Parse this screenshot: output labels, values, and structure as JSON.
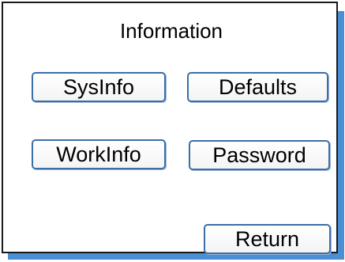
{
  "window": {
    "title": "Information"
  },
  "buttons": {
    "sysinfo": "SysInfo",
    "defaults": "Defaults",
    "workinfo": "WorkInfo",
    "password": "Password",
    "return": "Return"
  },
  "colors": {
    "border": "#1a1a1a",
    "shadow": "#4a8fd4",
    "button_border": "#3a6fa8"
  }
}
